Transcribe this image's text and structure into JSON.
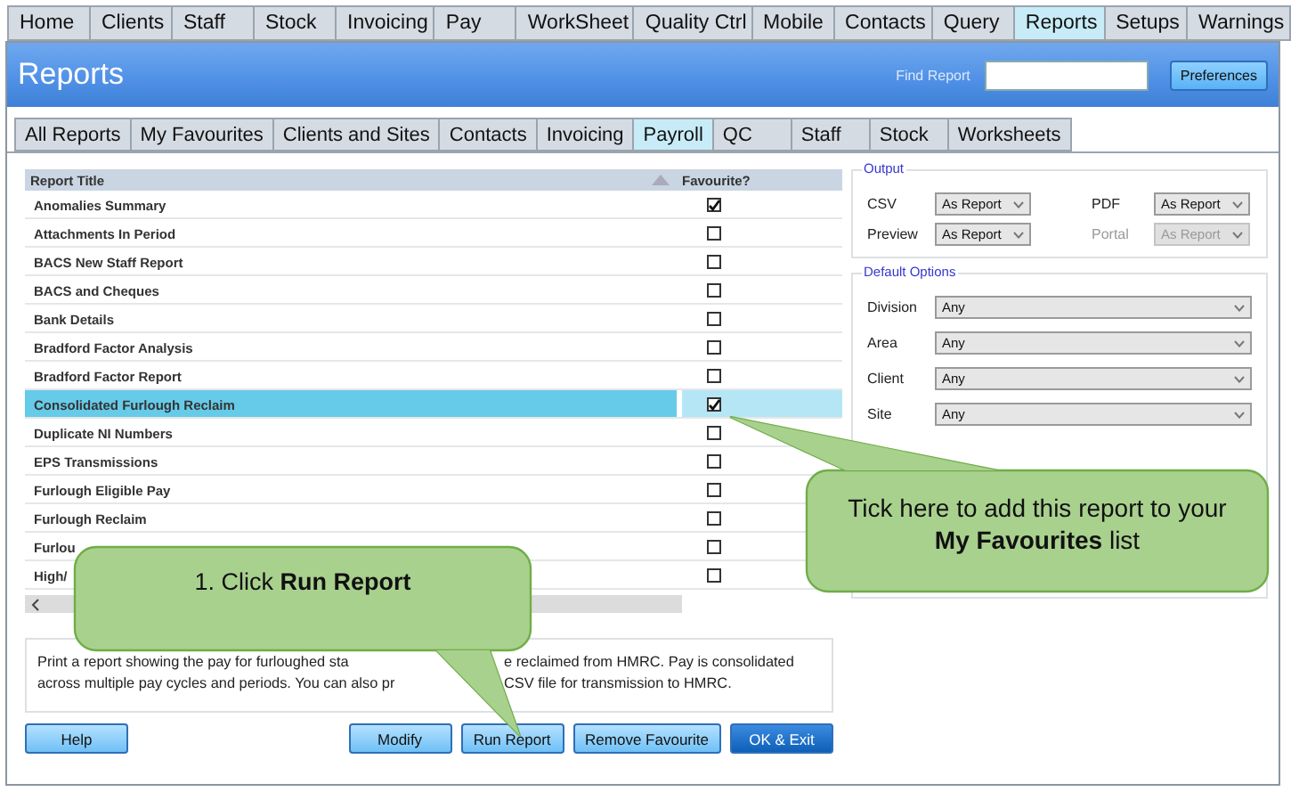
{
  "top_tabs": [
    {
      "label": "Home",
      "selected": false
    },
    {
      "label": "Clients",
      "selected": false
    },
    {
      "label": "Staff",
      "selected": false
    },
    {
      "label": "Stock",
      "selected": false
    },
    {
      "label": "Invoicing",
      "selected": false
    },
    {
      "label": "Pay",
      "selected": false
    },
    {
      "label": "WorkSheet",
      "selected": false
    },
    {
      "label": "Quality Ctrl",
      "selected": false
    },
    {
      "label": "Mobile",
      "selected": false
    },
    {
      "label": "Contacts",
      "selected": false
    },
    {
      "label": "Query",
      "selected": false
    },
    {
      "label": "Reports",
      "selected": true
    },
    {
      "label": "Setups",
      "selected": false
    },
    {
      "label": "Warnings",
      "selected": false
    }
  ],
  "header": {
    "title": "Reports",
    "find_label": "Find Report",
    "preferences_button": "Preferences"
  },
  "report_tabs": [
    {
      "label": "All Reports",
      "selected": false
    },
    {
      "label": "My Favourites",
      "selected": false
    },
    {
      "label": "Clients and Sites",
      "selected": false
    },
    {
      "label": "Contacts",
      "selected": false
    },
    {
      "label": "Invoicing",
      "selected": false
    },
    {
      "label": "Payroll",
      "selected": true
    },
    {
      "label": "QC",
      "selected": false
    },
    {
      "label": "Staff",
      "selected": false
    },
    {
      "label": "Stock",
      "selected": false
    },
    {
      "label": "Worksheets",
      "selected": false
    }
  ],
  "table": {
    "columns": [
      "Report Title",
      "Favourite?"
    ],
    "rows": [
      {
        "title": "Anomalies Summary",
        "favourite": true,
        "selected": false
      },
      {
        "title": "Attachments In Period",
        "favourite": false,
        "selected": false
      },
      {
        "title": "BACS New Staff Report",
        "favourite": false,
        "selected": false
      },
      {
        "title": "BACS and Cheques",
        "favourite": false,
        "selected": false
      },
      {
        "title": "Bank Details",
        "favourite": false,
        "selected": false
      },
      {
        "title": "Bradford Factor Analysis",
        "favourite": false,
        "selected": false
      },
      {
        "title": "Bradford Factor Report",
        "favourite": false,
        "selected": false
      },
      {
        "title": "Consolidated Furlough Reclaim",
        "favourite": true,
        "selected": true
      },
      {
        "title": "Duplicate NI Numbers",
        "favourite": false,
        "selected": false
      },
      {
        "title": "EPS Transmissions",
        "favourite": false,
        "selected": false
      },
      {
        "title": "Furlough Eligible Pay",
        "favourite": false,
        "selected": false
      },
      {
        "title": "Furlough Reclaim",
        "favourite": false,
        "selected": false
      },
      {
        "title": "Furlou",
        "favourite": false,
        "selected": false
      },
      {
        "title": "High/",
        "favourite": false,
        "selected": false
      }
    ]
  },
  "output": {
    "title": "Output",
    "fields": [
      {
        "label": "CSV",
        "value": "As Report",
        "disabled": false
      },
      {
        "label": "PDF",
        "value": "As Report",
        "disabled": false
      },
      {
        "label": "Preview",
        "value": "As Report",
        "disabled": false
      },
      {
        "label": "Portal",
        "value": "As Report",
        "disabled": true
      }
    ]
  },
  "default_options": {
    "title": "Default Options",
    "fields": [
      {
        "label": "Division",
        "value": "Any"
      },
      {
        "label": "Area",
        "value": "Any"
      },
      {
        "label": "Client",
        "value": "Any"
      },
      {
        "label": "Site",
        "value": "Any"
      }
    ]
  },
  "description": {
    "lines": [
      [
        "Print a report showing the pay for furloughed sta",
        "e reclaimed from HMRC. Pay is consolidated"
      ],
      [
        "across multiple pay cycles and periods. You can also pr",
        "CSV file for transmission to HMRC."
      ]
    ]
  },
  "buttons": [
    {
      "label": "Help",
      "kind": "normal"
    },
    {
      "label": "Modify",
      "kind": "normal"
    },
    {
      "label": "Run Report",
      "kind": "normal"
    },
    {
      "label": "Remove Favourite",
      "kind": "normal"
    },
    {
      "label": "OK & Exit",
      "kind": "primary"
    }
  ],
  "callouts": [
    {
      "text": "Tick here to add this report to your **My Favourites** list",
      "kind": "favourite"
    },
    {
      "text": "1. Click **Run Report**",
      "kind": "run"
    }
  ]
}
